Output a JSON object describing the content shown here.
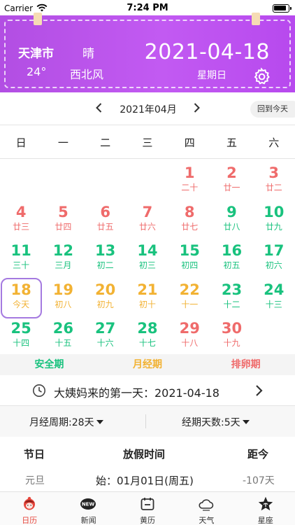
{
  "status_bar": {
    "carrier": "Carrier",
    "time": "7:24 PM"
  },
  "header": {
    "city": "天津市",
    "weather": "晴",
    "temperature": "24°",
    "wind": "西北风",
    "date": "2021-04-18",
    "weekday": "星期日"
  },
  "month_nav": {
    "label": "2021年04月",
    "today_button": "回到今天"
  },
  "weekdays": [
    "日",
    "一",
    "二",
    "三",
    "四",
    "五",
    "六"
  ],
  "colors": {
    "safe": "#19c27e",
    "period": "#f2b233",
    "ovulation": "#ef6b6b",
    "accent": "#b24ee3",
    "tab_active": "#e6463c"
  },
  "calendar": {
    "rows": [
      [
        null,
        null,
        null,
        null,
        {
          "day": "1",
          "lunar": "二十",
          "type": "ovulation"
        },
        {
          "day": "2",
          "lunar": "廿一",
          "type": "ovulation"
        },
        {
          "day": "3",
          "lunar": "廿二",
          "type": "ovulation"
        }
      ],
      [
        {
          "day": "4",
          "lunar": "廿三",
          "type": "ovulation"
        },
        {
          "day": "5",
          "lunar": "廿四",
          "type": "ovulation"
        },
        {
          "day": "6",
          "lunar": "廿五",
          "type": "ovulation"
        },
        {
          "day": "7",
          "lunar": "廿六",
          "type": "ovulation"
        },
        {
          "day": "8",
          "lunar": "廿七",
          "type": "ovulation"
        },
        {
          "day": "9",
          "lunar": "廿八",
          "type": "safe"
        },
        {
          "day": "10",
          "lunar": "廿九",
          "type": "safe"
        }
      ],
      [
        {
          "day": "11",
          "lunar": "三十",
          "type": "safe"
        },
        {
          "day": "12",
          "lunar": "三月",
          "type": "safe"
        },
        {
          "day": "13",
          "lunar": "初二",
          "type": "safe"
        },
        {
          "day": "14",
          "lunar": "初三",
          "type": "safe"
        },
        {
          "day": "15",
          "lunar": "初四",
          "type": "safe"
        },
        {
          "day": "16",
          "lunar": "初五",
          "type": "safe"
        },
        {
          "day": "17",
          "lunar": "初六",
          "type": "safe"
        }
      ],
      [
        {
          "day": "18",
          "lunar": "今天",
          "type": "period",
          "today": true
        },
        {
          "day": "19",
          "lunar": "初八",
          "type": "period"
        },
        {
          "day": "20",
          "lunar": "初九",
          "type": "period"
        },
        {
          "day": "21",
          "lunar": "初十",
          "type": "period"
        },
        {
          "day": "22",
          "lunar": "十一",
          "type": "period"
        },
        {
          "day": "23",
          "lunar": "十二",
          "type": "safe"
        },
        {
          "day": "24",
          "lunar": "十三",
          "type": "safe"
        }
      ],
      [
        {
          "day": "25",
          "lunar": "十四",
          "type": "safe"
        },
        {
          "day": "26",
          "lunar": "十五",
          "type": "safe"
        },
        {
          "day": "27",
          "lunar": "十六",
          "type": "safe"
        },
        {
          "day": "28",
          "lunar": "十七",
          "type": "safe"
        },
        {
          "day": "29",
          "lunar": "十八",
          "type": "ovulation"
        },
        {
          "day": "30",
          "lunar": "十九",
          "type": "ovulation"
        },
        null
      ]
    ]
  },
  "legend": {
    "safe": "安全期",
    "period": "月经期",
    "ovulation": "排卵期"
  },
  "first_day": {
    "text": "大姨妈来的第一天：2021-04-18"
  },
  "cycle": {
    "cycle_length": "月经周期:28天",
    "period_length": "经期天数:5天"
  },
  "holidays": {
    "headers": {
      "name": "节日",
      "time": "放假时间",
      "days": "距今"
    },
    "rows": [
      {
        "name": "元旦",
        "time": "始：01月01日(周五)",
        "days": "-107天"
      }
    ]
  },
  "tabs": [
    {
      "label": "日历",
      "icon": "girl-face-icon",
      "active": true
    },
    {
      "label": "新闻",
      "icon": "news-new-icon",
      "active": false
    },
    {
      "label": "黄历",
      "icon": "almanac-calendar-icon",
      "active": false
    },
    {
      "label": "天气",
      "icon": "cloud-weather-icon",
      "active": false
    },
    {
      "label": "星座",
      "icon": "star-constellation-icon",
      "active": false
    }
  ]
}
